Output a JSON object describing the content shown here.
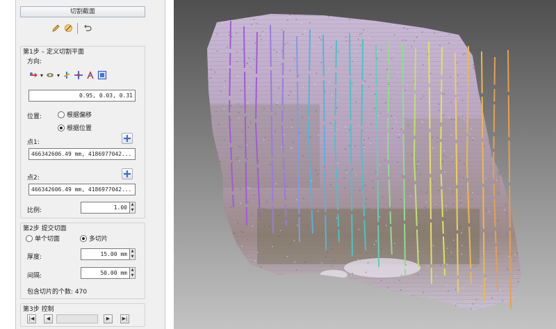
{
  "panel": {
    "title": "切割截面",
    "step1": {
      "header": "第1步 – 定义切割平面",
      "direction_label": "方向:",
      "direction_value": "0.95, 0.03, 0.31",
      "position_label": "位置:",
      "option_by_offset": "根据偏移",
      "option_by_position": "根据位置",
      "point1_label": "点1:",
      "point1_value": "466342606.49 mm, 4186977042...",
      "point2_label": "点2:",
      "point2_value": "466342606.49 mm, 4186977042...",
      "scale_label": "比例:",
      "scale_value": "1.00"
    },
    "step2": {
      "header": "第2步 提交切面",
      "option_single": "单个切面",
      "option_multi": "多切片",
      "thickness_label": "厚度:",
      "thickness_value": "15.00 mm",
      "spacing_label": "间隔:",
      "spacing_value": "50.00 mm",
      "count_text": "包含切片的个数: 470"
    },
    "step3": {
      "header": "第3步 控制"
    }
  },
  "icons": [
    "edit-icon",
    "clear-icon",
    "undo-icon",
    "axis-x-icon",
    "axis-y-icon",
    "axis-z-icon",
    "crosshair-icon",
    "pick-icon",
    "view-icon",
    "plus-icon",
    "first-icon",
    "prev-icon",
    "next-icon",
    "last-icon"
  ],
  "colors": {
    "panel_bg": "#f0f0f0",
    "accent_blue": "#3a7bd5",
    "cloud_base": "#b7a6bf",
    "slice_purple": "#a25ad6",
    "slice_teal": "#44c6c8",
    "slice_yellow": "#e3e35a",
    "slice_orange": "#e8a14a"
  }
}
